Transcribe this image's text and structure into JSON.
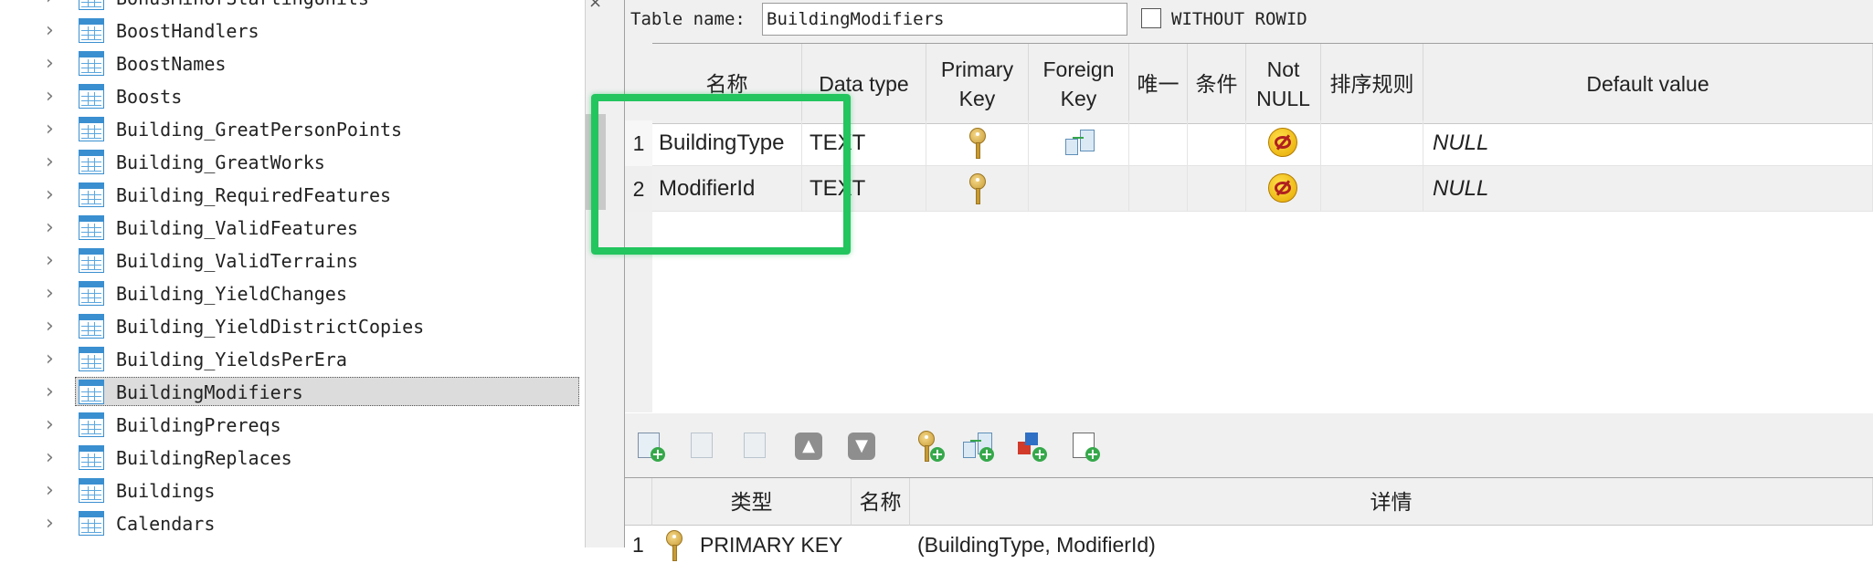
{
  "tree": {
    "items": [
      {
        "label": "BonusMinorStartingUnits",
        "selected": false
      },
      {
        "label": "BoostHandlers",
        "selected": false
      },
      {
        "label": "BoostNames",
        "selected": false
      },
      {
        "label": "Boosts",
        "selected": false
      },
      {
        "label": "Building_GreatPersonPoints",
        "selected": false
      },
      {
        "label": "Building_GreatWorks",
        "selected": false
      },
      {
        "label": "Building_RequiredFeatures",
        "selected": false
      },
      {
        "label": "Building_ValidFeatures",
        "selected": false
      },
      {
        "label": "Building_ValidTerrains",
        "selected": false
      },
      {
        "label": "Building_YieldChanges",
        "selected": false
      },
      {
        "label": "Building_YieldDistrictCopies",
        "selected": false
      },
      {
        "label": "Building_YieldsPerEra",
        "selected": false
      },
      {
        "label": "BuildingModifiers",
        "selected": true
      },
      {
        "label": "BuildingPrereqs",
        "selected": false
      },
      {
        "label": "BuildingReplaces",
        "selected": false
      },
      {
        "label": "Buildings",
        "selected": false
      },
      {
        "label": "Calendars",
        "selected": false
      }
    ],
    "chevron": "›",
    "table_icon": "table-icon"
  },
  "splitter": {
    "close_glyph": "×"
  },
  "table_name": {
    "label": "Table name:",
    "value": "BuildingModifiers",
    "without_rowid_label": "WITHOUT ROWID",
    "without_rowid_checked": false
  },
  "fields": {
    "headers": {
      "name": "名称",
      "data_type": "Data type",
      "primary_key": "Primary Key",
      "foreign_key": "Foreign Key",
      "unique": "唯一",
      "check": "条件",
      "not_null": "Not NULL",
      "collate": "排序规则",
      "default": "Default value"
    },
    "rows": [
      {
        "num": "1",
        "name": "BuildingType",
        "type": "TEXT",
        "pk": true,
        "fk": true,
        "unique": false,
        "check": "",
        "not_null": true,
        "collate": "",
        "default": "NULL"
      },
      {
        "num": "2",
        "name": "ModifierId",
        "type": "TEXT",
        "pk": true,
        "fk": false,
        "unique": false,
        "check": "",
        "not_null": true,
        "collate": "",
        "default": "NULL"
      }
    ]
  },
  "toolbar": {
    "buttons": [
      {
        "icon": "add-column-icon",
        "enabled": true
      },
      {
        "icon": "edit-column-icon",
        "enabled": false
      },
      {
        "icon": "delete-column-icon",
        "enabled": false
      },
      {
        "icon": "move-up-icon",
        "enabled": false
      },
      {
        "icon": "move-down-icon",
        "enabled": false
      },
      {
        "icon": "add-primary-key-icon",
        "enabled": true
      },
      {
        "icon": "add-foreign-key-icon",
        "enabled": true
      },
      {
        "icon": "add-unique-icon",
        "enabled": true
      },
      {
        "icon": "add-check-icon",
        "enabled": true
      }
    ],
    "up_glyph": "▲",
    "down_glyph": "▼"
  },
  "constraints": {
    "headers": {
      "type": "类型",
      "name": "名称",
      "details": "详情"
    },
    "rows": [
      {
        "num": "1",
        "type": "PRIMARY KEY",
        "name": "",
        "details": "(BuildingType, ModifierId)"
      }
    ]
  },
  "highlight_color": "#22c55e"
}
